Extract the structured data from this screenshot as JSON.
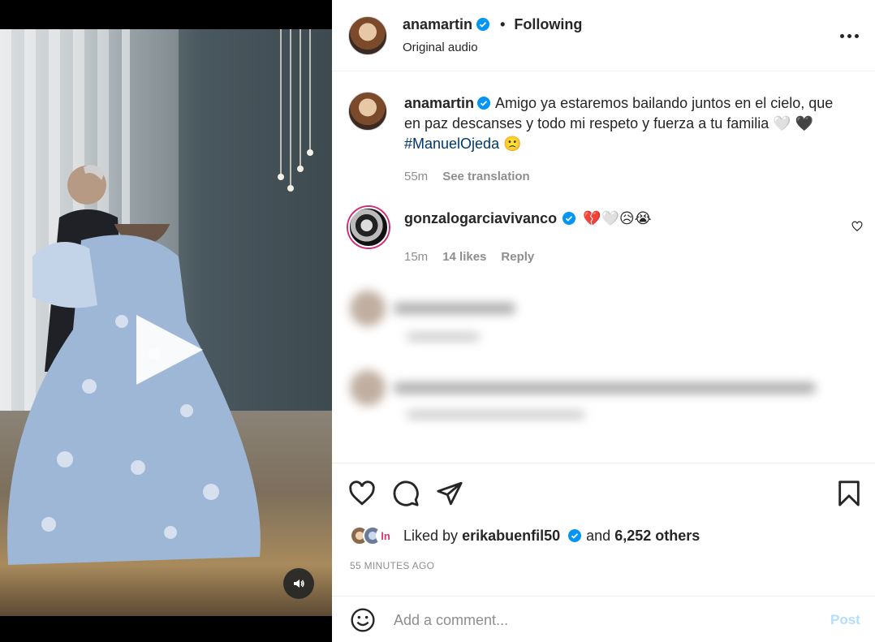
{
  "post": {
    "author": "anamartin",
    "follow_status": "Following",
    "separator": "•",
    "audio": "Original audio"
  },
  "caption": {
    "author": "anamartin",
    "text": "Amigo ya estaremos bailando juntos en el cielo, que en paz descanses y todo mi respeto y fuerza a tu familia 🤍 🖤 ",
    "hashtag": "#ManuelOjeda",
    "emoji_after": " 🙁",
    "time": "55m",
    "see_translation": "See translation"
  },
  "comment": {
    "author": "gonzalogarciavivanco",
    "text": "💔🤍😥😭",
    "time": "15m",
    "likes": "14 likes",
    "reply": "Reply"
  },
  "likes": {
    "prefix": "Liked by",
    "liker": "erikabuenfil50",
    "middle": "and",
    "others": "6,252 others",
    "third_avatar_text": "ln"
  },
  "timestamp": "55 MINUTES AGO",
  "add_comment": {
    "placeholder": "Add a comment...",
    "post_label": "Post"
  },
  "colors": {
    "verified": "#0095f6",
    "hashtag": "#00376b",
    "post_disabled": "#b2dffc",
    "story_ring": "#d62976"
  },
  "icons": [
    "play-icon",
    "volume-icon",
    "verified-icon",
    "more-icon",
    "heart-icon",
    "comment-icon",
    "share-icon",
    "bookmark-icon",
    "emoji-icon"
  ]
}
